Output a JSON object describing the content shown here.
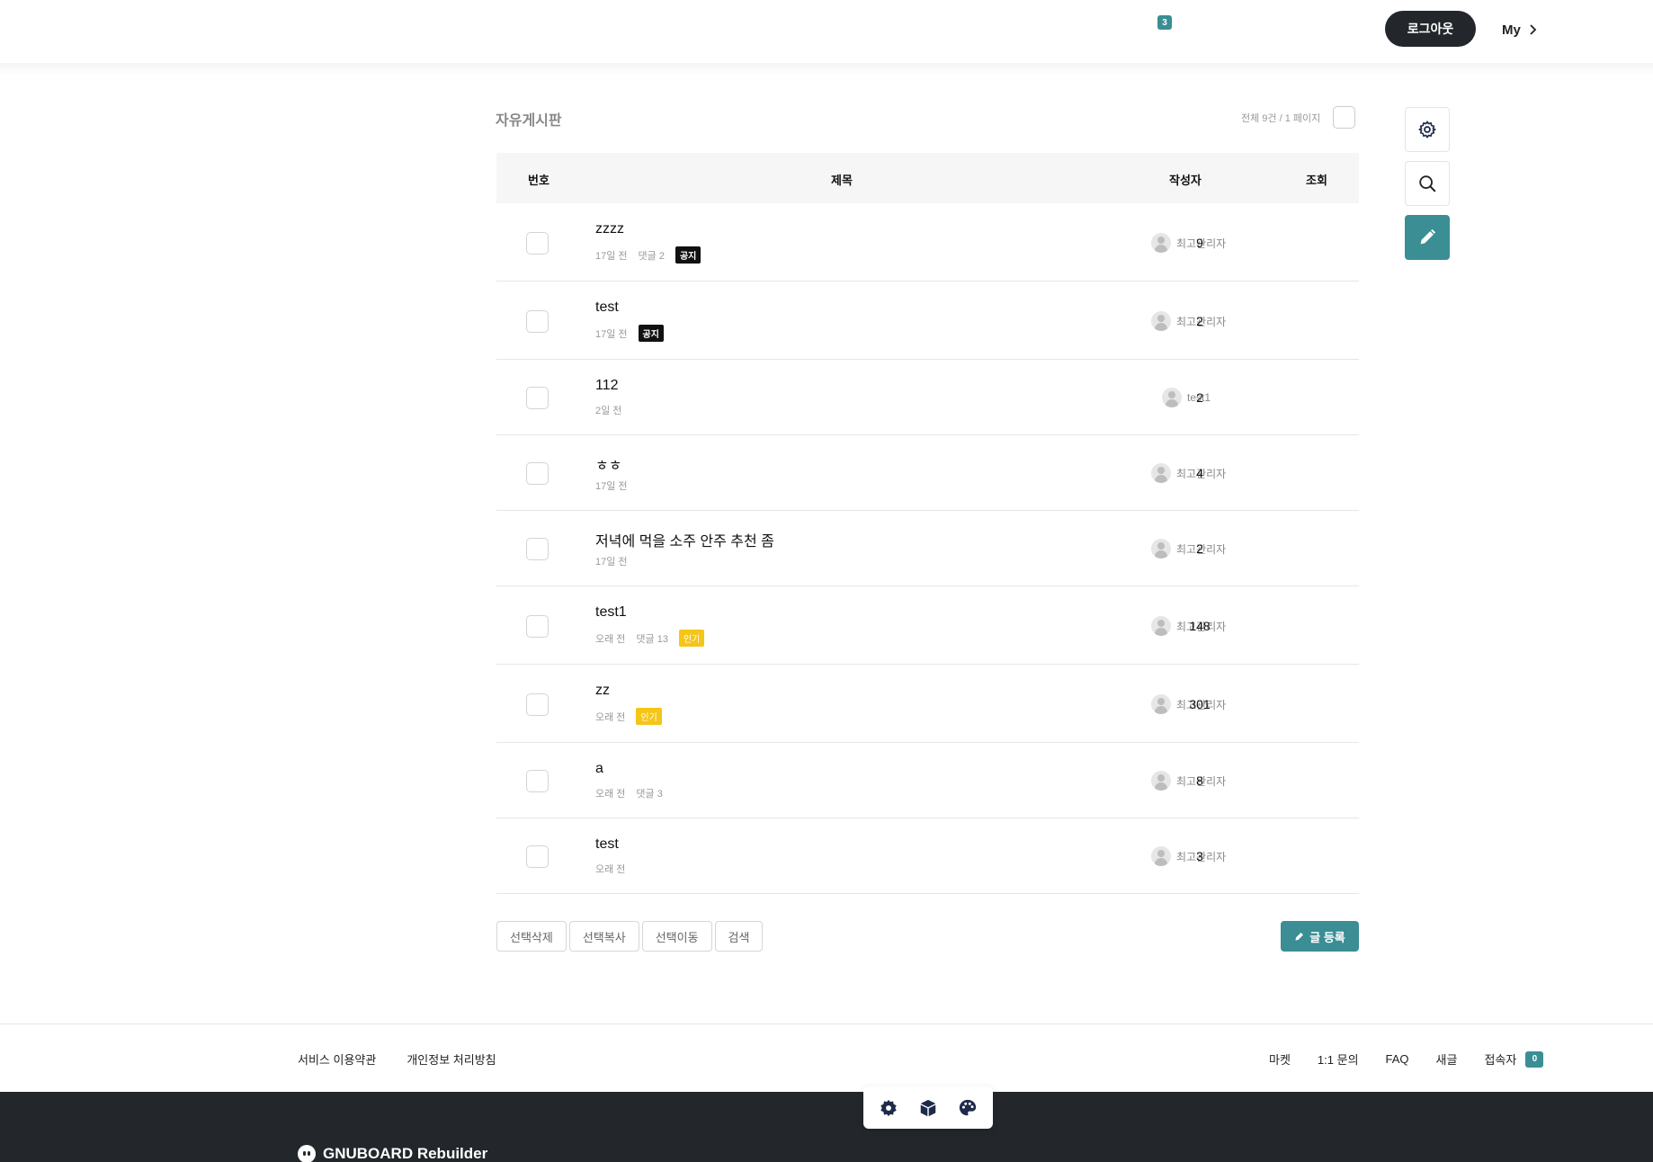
{
  "header": {
    "notification_count": "3",
    "logout_label": "로그아웃",
    "my_label": "My"
  },
  "board": {
    "title": "자유게시판",
    "count_text": "전체 9건 / 1 페이지",
    "columns": {
      "num": "번호",
      "subject": "제목",
      "author": "작성자",
      "views": "조회"
    }
  },
  "posts": [
    {
      "title": "zzzz",
      "date": "17일 전",
      "comments": "댓글 2",
      "badge": "공지",
      "author": "최고관리자",
      "views": "9"
    },
    {
      "title": "test",
      "date": "17일 전",
      "comments": "",
      "badge": "공지",
      "author": "최고관리자",
      "views": "2"
    },
    {
      "title": "112",
      "date": "2일 전",
      "comments": "",
      "badge": "",
      "author": "test1",
      "views": "2"
    },
    {
      "title": "ㅎㅎ",
      "date": "17일 전",
      "comments": "",
      "badge": "",
      "author": "최고관리자",
      "views": "4"
    },
    {
      "title": "저녁에 먹을 소주 안주 추천 좀",
      "date": "17일 전",
      "comments": "",
      "badge": "",
      "author": "최고관리자",
      "views": "2"
    },
    {
      "title": "test1",
      "date": "오래 전",
      "comments": "댓글 13",
      "badge": "인기",
      "author": "최고관리자",
      "views": "148"
    },
    {
      "title": "zz",
      "date": "오래 전",
      "comments": "",
      "badge": "인기",
      "author": "최고관리자",
      "views": "301"
    },
    {
      "title": "a",
      "date": "오래 전",
      "comments": "댓글 3",
      "badge": "",
      "author": "최고관리자",
      "views": "8"
    },
    {
      "title": "test",
      "date": "오래 전",
      "comments": "",
      "badge": "",
      "author": "최고관리자",
      "views": "3"
    }
  ],
  "actions": {
    "delete": "선택삭제",
    "copy": "선택복사",
    "move": "선택이동",
    "search": "검색",
    "write": "글 등록"
  },
  "footer": {
    "terms": "서비스 이용약관",
    "privacy": "개인정보 처리방침",
    "market": "마켓",
    "inquiry": "1:1 문의",
    "faq": "FAQ",
    "new": "새글",
    "visitors": "접속자",
    "visitor_count": "0",
    "brand": "GNUBOARD Rebuilder"
  },
  "colors": {
    "accent": "#3a8e94",
    "dark": "#23272b",
    "hot_badge": "#f5c518",
    "notice_badge": "#111111"
  }
}
